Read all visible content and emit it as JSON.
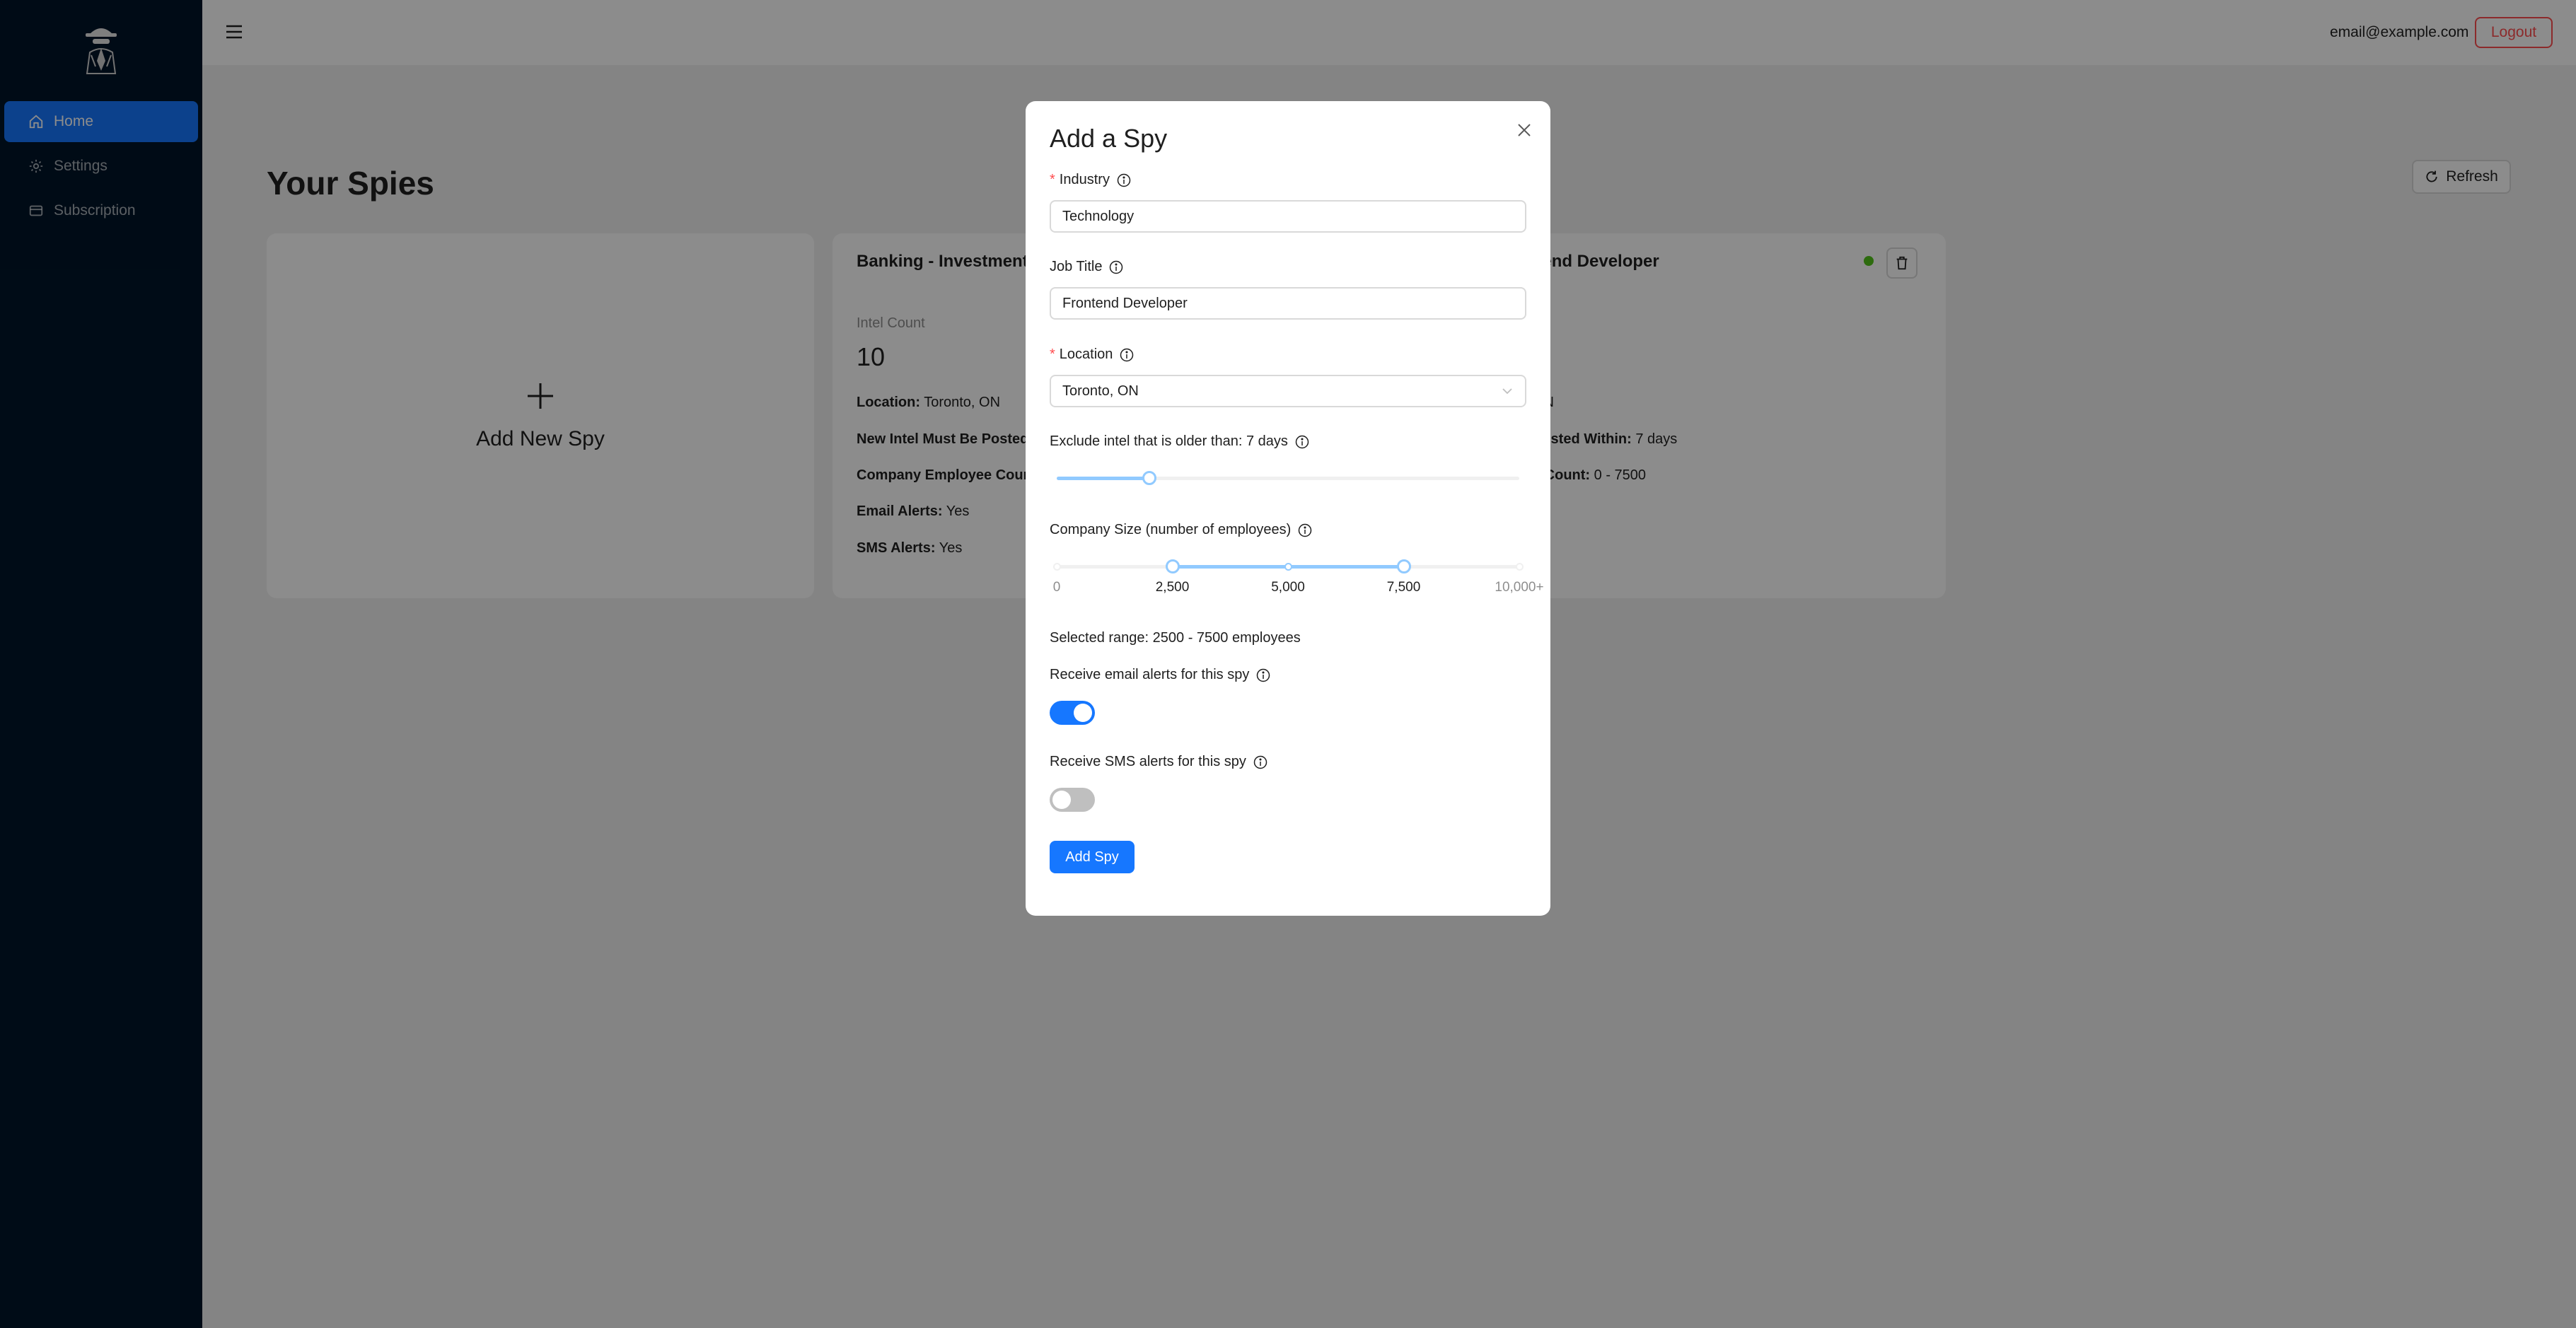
{
  "sidebar": {
    "items": [
      {
        "label": "Home",
        "icon": "home-icon",
        "active": true
      },
      {
        "label": "Settings",
        "icon": "gear-icon"
      },
      {
        "label": "Subscription",
        "icon": "credit-card-icon"
      }
    ]
  },
  "header": {
    "email": "email@example.com",
    "logout_label": "Logout"
  },
  "page": {
    "title": "Your Spies",
    "refresh_label": "Refresh",
    "add_card_label": "Add New Spy"
  },
  "spies": [
    {
      "title": "Banking - Investment A",
      "intel_count_label": "Intel Count",
      "intel_count": "10",
      "location_label": "Location:",
      "location": "Toronto, ON",
      "posted_label": "New Intel Must Be Posted",
      "employee_label": "Company Employee Coun",
      "email_alerts_label": "Email Alerts:",
      "email_alerts": "Yes",
      "sms_alerts_label": "SMS Alerts:",
      "sms_alerts": "Yes"
    },
    {
      "title": "kend Developer",
      "location_tail": "ON",
      "posted_label": "Posted Within:",
      "posted": "7 days",
      "employee_label": "e Count:",
      "employee": "0 - 7500",
      "status_color": "#52c41a"
    }
  ],
  "modal": {
    "title": "Add a Spy",
    "industry": {
      "label": "Industry",
      "value": "Technology"
    },
    "job_title": {
      "label": "Job Title",
      "value": "Frontend Developer"
    },
    "location": {
      "label": "Location",
      "value": "Toronto, ON"
    },
    "age_slider": {
      "label": "Exclude intel that is older than: 7 days",
      "fraction": 0.2
    },
    "company_size": {
      "label": "Company Size (number of employees)",
      "min": 0,
      "max": 10000,
      "selected": [
        2500,
        7500
      ],
      "marks": [
        "0",
        "2,500",
        "5,000",
        "7,500",
        "10,000+"
      ]
    },
    "range_text": "Selected range: 2500 - 7500 employees",
    "email_alerts": {
      "label": "Receive email alerts for this spy",
      "on": true
    },
    "sms_alerts": {
      "label": "Receive SMS alerts for this spy",
      "on": false
    },
    "submit_label": "Add Spy"
  },
  "colors": {
    "primary": "#1677ff",
    "sidebar": "#001529",
    "danger": "#ff4d4f",
    "slider_track": "#91caff"
  }
}
